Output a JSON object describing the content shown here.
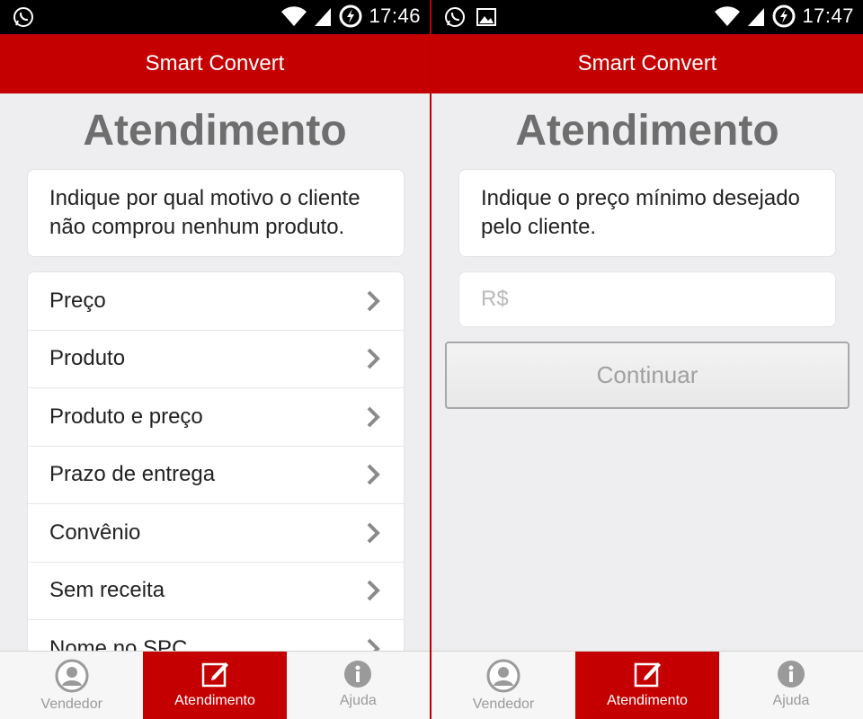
{
  "left": {
    "status": {
      "time": "17:46"
    },
    "app_title": "Smart Convert",
    "page_title": "Atendimento",
    "instruction": "Indique por qual motivo o cliente não comprou nenhum produto.",
    "reasons": [
      "Preço",
      "Produto",
      "Produto e preço",
      "Prazo de entrega",
      "Convênio",
      "Sem receita",
      "Nome no SPC"
    ],
    "tabs": {
      "vendedor": "Vendedor",
      "atendimento": "Atendimento",
      "ajuda": "Ajuda"
    }
  },
  "right": {
    "status": {
      "time": "17:47"
    },
    "app_title": "Smart Convert",
    "page_title": "Atendimento",
    "instruction": "Indique o preço mínimo desejado pelo cliente.",
    "price_input": {
      "placeholder": "R$"
    },
    "continue_label": "Continuar",
    "tabs": {
      "vendedor": "Vendedor",
      "atendimento": "Atendimento",
      "ajuda": "Ajuda"
    }
  },
  "colors": {
    "accent": "#c40000",
    "title_gray": "#6e6e6e",
    "background": "#eeeef0"
  },
  "icons": [
    "whatsapp-icon",
    "image-icon",
    "wifi-icon",
    "signal-icon",
    "battery-charging-icon",
    "chevron-right-icon",
    "user-icon",
    "edit-icon",
    "info-icon"
  ]
}
